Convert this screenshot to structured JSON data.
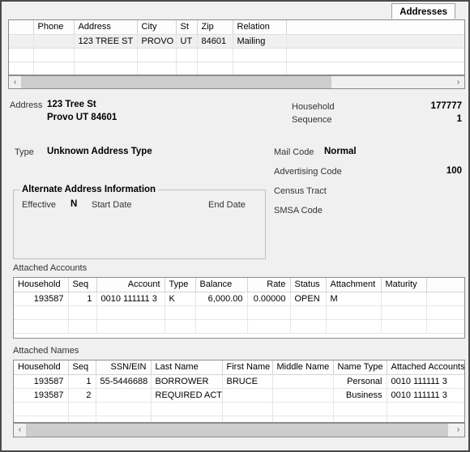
{
  "window": {
    "tab_label": "Addresses"
  },
  "address_grid": {
    "columns": [
      "",
      "Phone",
      "Address",
      "City",
      "St",
      "Zip",
      "Relation",
      ""
    ],
    "rows": [
      {
        "blank": "",
        "phone": "",
        "address": "123 TREE ST",
        "city": "PROVO",
        "state": "UT",
        "zip": "84601",
        "relation": "Mailing",
        "pad": "",
        "selected": true
      },
      {
        "blank": "",
        "phone": "",
        "address": "",
        "city": "",
        "state": "",
        "zip": "",
        "relation": "",
        "pad": "",
        "selected": false
      },
      {
        "blank": "",
        "phone": "",
        "address": "",
        "city": "",
        "state": "",
        "zip": "",
        "relation": "",
        "pad": "",
        "selected": false
      }
    ],
    "scrollbar": {
      "left_arrow": "‹",
      "right_arrow": "›"
    }
  },
  "details": {
    "address_label": "Address",
    "address_line1": "123 Tree St",
    "address_line2": "Provo UT 84601",
    "type_label": "Type",
    "type_value": "Unknown Address Type",
    "household_label": "Household",
    "household_value": "177777",
    "sequence_label": "Sequence",
    "sequence_value": "1",
    "mail_code_label": "Mail Code",
    "mail_code_value": "Normal",
    "advertising_code_label": "Advertising Code",
    "advertising_code_value": "100",
    "census_tract_label": "Census Tract",
    "census_tract_value": "",
    "smsa_code_label": "SMSA Code",
    "smsa_code_value": ""
  },
  "alternate_address": {
    "title": "Alternate Address Information",
    "effective_label": "Effective",
    "effective_value": "N",
    "start_date_label": "Start Date",
    "start_date_value": "",
    "end_date_label": "End Date",
    "end_date_value": ""
  },
  "attached_accounts": {
    "section_label": "Attached Accounts",
    "columns": [
      "Household",
      "Seq",
      "Account",
      "Type",
      "Balance",
      "Rate",
      "Status",
      "Attachment",
      "Maturity",
      ""
    ],
    "rows": [
      {
        "household": "193587",
        "seq": "1",
        "account": "0010 111111 3",
        "type": "K",
        "balance": "6,000.00",
        "rate": "0.00000",
        "status": "OPEN",
        "attachment": "M",
        "maturity": "",
        "pad": ""
      },
      {
        "household": "",
        "seq": "",
        "account": "",
        "type": "",
        "balance": "",
        "rate": "",
        "status": "",
        "attachment": "",
        "maturity": "",
        "pad": ""
      },
      {
        "household": "",
        "seq": "",
        "account": "",
        "type": "",
        "balance": "",
        "rate": "",
        "status": "",
        "attachment": "",
        "maturity": "",
        "pad": ""
      }
    ]
  },
  "attached_names": {
    "section_label": "Attached Names",
    "columns": [
      "Household",
      "Seq",
      "SSN/EIN",
      "Last Name",
      "First Name",
      "Middle Name",
      "Name Type",
      "Attached Accounts"
    ],
    "rows": [
      {
        "household": "193587",
        "seq": "1",
        "ssn_ein": "55-5446688",
        "last_name": "BORROWER",
        "first_name": "BRUCE",
        "middle_name": "",
        "name_type": "Personal",
        "attached_accounts": "0010 111111 3"
      },
      {
        "household": "193587",
        "seq": "2",
        "ssn_ein": "",
        "last_name": "REQUIRED ACT",
        "first_name": "",
        "middle_name": "",
        "name_type": "Business",
        "attached_accounts": "0010 111111 3"
      },
      {
        "household": "",
        "seq": "",
        "ssn_ein": "",
        "last_name": "",
        "first_name": "",
        "middle_name": "",
        "name_type": "",
        "attached_accounts": ""
      },
      {
        "household": "",
        "seq": "",
        "ssn_ein": "",
        "last_name": "",
        "first_name": "",
        "middle_name": "",
        "name_type": "",
        "attached_accounts": ""
      }
    ],
    "scrollbar": {
      "left_arrow": "‹",
      "right_arrow": "›"
    }
  }
}
